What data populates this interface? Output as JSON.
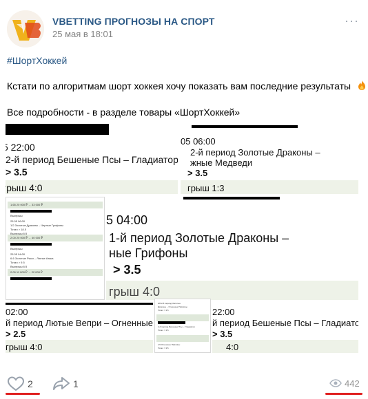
{
  "post": {
    "author": "VBETTING ПРОГНОЗЫ НА СПОРТ",
    "date": "25 мая в 18:01",
    "more_glyph": "···",
    "hashtag": "#ШортХоккей",
    "text_line1": "Кстати по алгоритмам шорт хоккея хочу показать вам последние результаты",
    "text_line1_emoji": "fire-icon",
    "text_line2": "Все подробности - в разделе товары «ШортХоккей»"
  },
  "gallery": {
    "tile1": {
      "time": "5 22:00",
      "title": "2-й период Бешеные Псы – Гладиатор",
      "bet": "> 3.5",
      "result": "грыш 4:0"
    },
    "tile2": {
      "time": "05 06:00",
      "title1": "2-й период Золотые Драконы –",
      "title2": "жные Медведи",
      "bet": "> 3.5",
      "result": "грыш 1:3"
    },
    "tile3": {
      "time": "5 04:00",
      "title1": "1-й период Золотые Драконы –",
      "title2": "ные Грифоны",
      "bet": "> 3.5",
      "result": "грыш 4:0"
    },
    "tile4": {
      "time": "02:00",
      "title": "й период Лютые Вепри – Огненные П",
      "bet": "> 2.5",
      "result": "грыш 4:0"
    },
    "tile5": {
      "time": "22:00",
      "title": "й период Бешеные Псы – Гладиатор",
      "bet": "> 3.5",
      "result": "4:0"
    },
    "mini_left": {
      "rows": [
        "1.65  20 000 ₽ → 33 000 ₽",
        "Выигрыш",
        "25.05 06:00",
        "1/2  Золотые Драконы – Черные Грифоны",
        "Тотал > 18.5",
        "Выигрыш 6:5",
        "2.00  20 000 ₽ → 40 000 ₽",
        "Выигрыш",
        "25.05 04:00",
        "6-6  Золотые Рыси – Лютые Атака",
        "Тотал > 9.5",
        "Выигрыш 6:5",
        "2.00  11 000 ₽ → 22 000 ₽"
      ]
    },
    "mini_right": {
      "rows": [
        "6/8  2-й период Золотые",
        "Драконы – Огненные Павлины",
        "Тотал > 3.5",
        "2-й период Бешеные Псы – Гладиатор",
        "Тотал > 3.5",
        "1/2  Огненные Павлины",
        "Тотал > 3.5"
      ]
    }
  },
  "footer": {
    "likes": "2",
    "shares": "1",
    "views": "442",
    "like_icon": "heart-icon",
    "share_icon": "share-arrow-icon",
    "view_icon": "eye-icon"
  },
  "colors": {
    "link": "#2a5885",
    "accent_red": "#e02020",
    "result_bg": "#eef2e8"
  }
}
